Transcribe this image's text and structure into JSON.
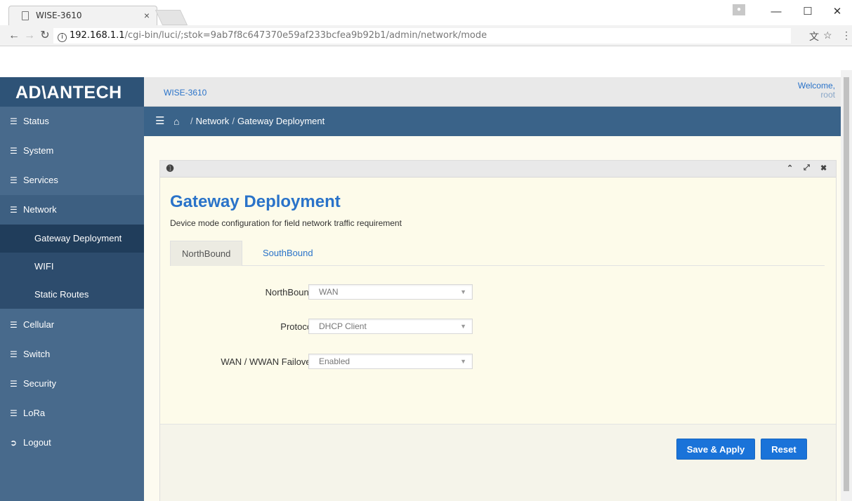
{
  "browser": {
    "tab_title": "WISE-3610",
    "tab_close": "×",
    "url_host": "192.168.1.1",
    "url_path": "/cgi-bin/luci/;stok=9ab7f8c647370e59af233bcfea9b92b1/admin/network/mode",
    "icons": [
      "page-icon",
      "back-icon",
      "forward-icon",
      "reload-icon",
      "info-icon",
      "translate-icon",
      "star-icon",
      "menu-icon",
      "minimize-icon",
      "maximize-icon",
      "close-icon"
    ]
  },
  "header": {
    "logo": "AD\\ANTECH",
    "device_name": "WISE-3610",
    "welcome": "Welcome,",
    "user": "root"
  },
  "sidebar": {
    "items": [
      {
        "label": "Status"
      },
      {
        "label": "System"
      },
      {
        "label": "Services"
      },
      {
        "label": "Network"
      },
      {
        "label": "Cellular"
      },
      {
        "label": "Switch"
      },
      {
        "label": "Security"
      },
      {
        "label": "LoRa"
      },
      {
        "label": "Logout"
      }
    ],
    "network_subitems": [
      {
        "label": "Gateway Deployment",
        "active": true
      },
      {
        "label": "WIFI"
      },
      {
        "label": "Static Routes"
      }
    ]
  },
  "breadcrumb": {
    "network": "Network",
    "current": "Gateway Deployment"
  },
  "page": {
    "title": "Gateway Deployment",
    "description": "Device mode configuration for field network traffic requirement",
    "tabs": [
      {
        "label": "NorthBound",
        "active": true
      },
      {
        "label": "SouthBound",
        "active": false
      }
    ],
    "fields": [
      {
        "label": "NorthBound",
        "value": "WAN"
      },
      {
        "label": "Protocol",
        "value": "DHCP Client"
      },
      {
        "label": "WAN / WWAN Failover",
        "value": "Enabled"
      }
    ],
    "save_label": "Save & Apply",
    "reset_label": "Reset"
  },
  "colors": {
    "sidebar": "#486a8c",
    "breadcrumb": "#3a6389",
    "accent": "#2a73c9",
    "button": "#1a73d9"
  }
}
